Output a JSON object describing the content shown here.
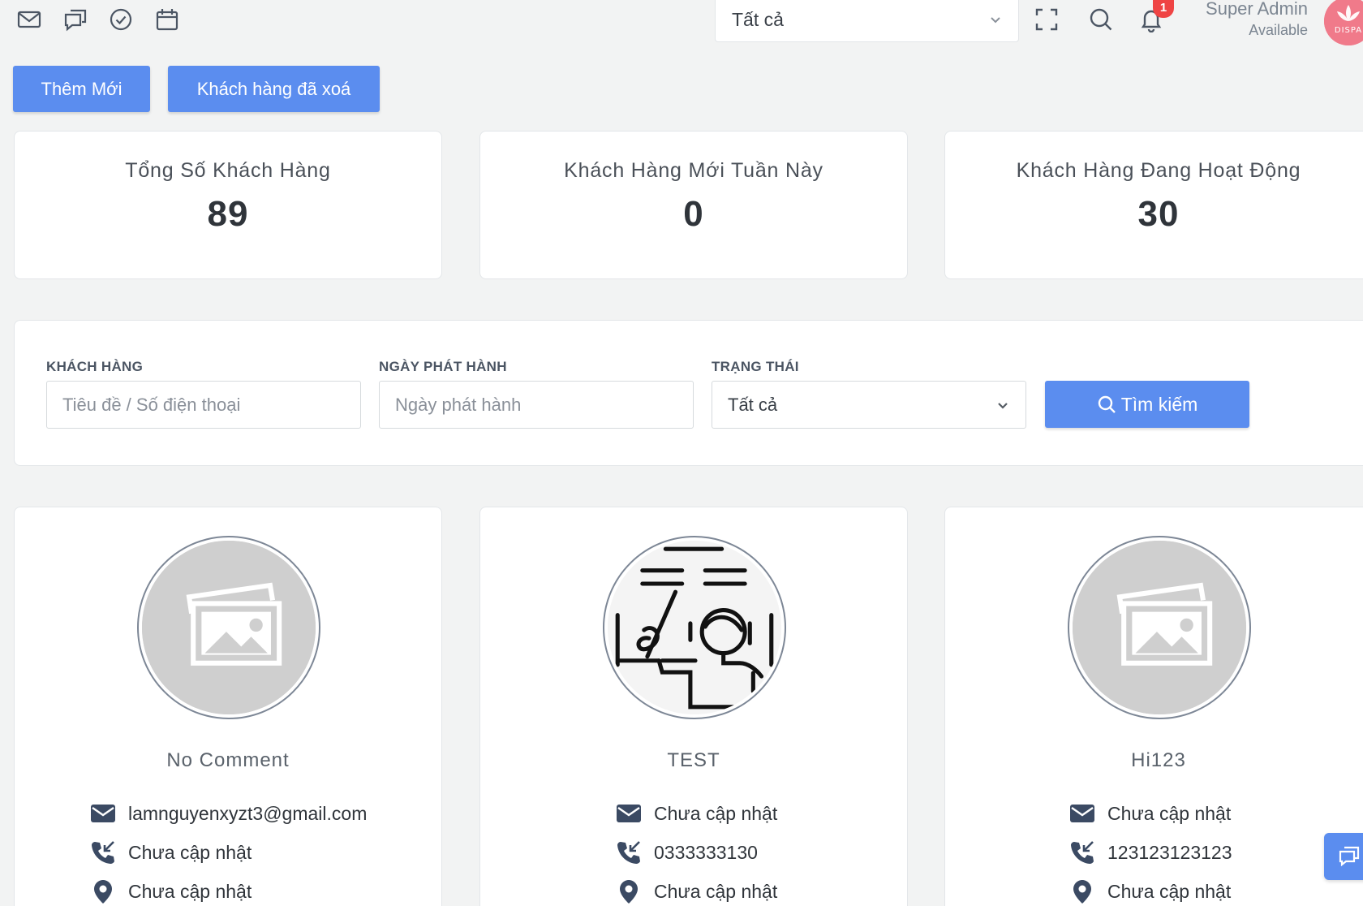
{
  "header": {
    "icons": [
      "mail-icon",
      "chat-icon",
      "check-circle-icon",
      "calendar-icon"
    ],
    "filter_select_value": "Tất cả",
    "notification_count": "1",
    "user_name": "Super Admin",
    "user_status": "Available",
    "logo_text": "DISPA"
  },
  "actions": {
    "add_new_label": "Thêm Mới",
    "deleted_customers_label": "Khách hàng đã xoá"
  },
  "stats": [
    {
      "title": "Tổng Số Khách Hàng",
      "value": "89"
    },
    {
      "title": "Khách Hàng Mới Tuần Này",
      "value": "0"
    },
    {
      "title": "Khách Hàng Đang Hoạt Động",
      "value": "30"
    }
  ],
  "filters": {
    "customer_label": "KHÁCH HÀNG",
    "customer_placeholder": "Tiêu đề / Số điện thoại",
    "date_label": "NGÀY PHÁT HÀNH",
    "date_placeholder": "Ngày phát hành",
    "status_label": "TRẠNG THÁI",
    "status_value": "Tất cả",
    "search_label": "Tìm kiếm"
  },
  "customers": [
    {
      "name": "No Comment",
      "avatar": "placeholder-image",
      "email": "lamnguyenxyzt3@gmail.com",
      "phone": "Chưa cập nhật",
      "address": "Chưa cập nhật"
    },
    {
      "name": "TEST",
      "avatar": "line-drawing",
      "email": "Chưa cập nhật",
      "phone": "0333333130",
      "address": "Chưa cập nhật"
    },
    {
      "name": "Hi123",
      "avatar": "placeholder-image",
      "email": "Chưa cập nhật",
      "phone": "123123123123",
      "address": "Chưa cập nhật"
    }
  ],
  "colors": {
    "primary": "#5b8def",
    "background": "#f2f3f3",
    "badge": "#ef4444",
    "icon": "#3b4a63"
  }
}
